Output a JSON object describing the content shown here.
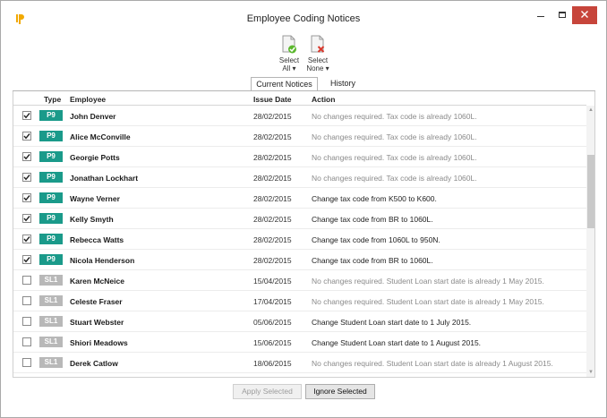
{
  "window": {
    "title": "Employee Coding Notices",
    "min_glyph": "–",
    "close_glyph": "✕"
  },
  "toolbar": {
    "select_all_line1": "Select",
    "select_all_line2": "All ▾",
    "select_none_line1": "Select",
    "select_none_line2": "None ▾"
  },
  "tabs": {
    "current": "Current Notices",
    "history": "History"
  },
  "table": {
    "headers": {
      "type": "Type",
      "employee": "Employee",
      "issue_date": "Issue Date",
      "action": "Action"
    },
    "rows": [
      {
        "checked": true,
        "type": "P9",
        "employee": "John Denver",
        "date": "28/02/2015",
        "action": "No changes required. Tax code is already 1060L.",
        "muted": true
      },
      {
        "checked": true,
        "type": "P9",
        "employee": "Alice McConville",
        "date": "28/02/2015",
        "action": "No changes required. Tax code is already 1060L.",
        "muted": true
      },
      {
        "checked": true,
        "type": "P9",
        "employee": "Georgie Potts",
        "date": "28/02/2015",
        "action": "No changes required. Tax code is already 1060L.",
        "muted": true
      },
      {
        "checked": true,
        "type": "P9",
        "employee": "Jonathan Lockhart",
        "date": "28/02/2015",
        "action": "No changes required. Tax code is already 1060L.",
        "muted": true
      },
      {
        "checked": true,
        "type": "P9",
        "employee": "Wayne Verner",
        "date": "28/02/2015",
        "action": "Change tax code from K500 to K600.",
        "muted": false
      },
      {
        "checked": true,
        "type": "P9",
        "employee": "Kelly Smyth",
        "date": "28/02/2015",
        "action": "Change tax code from BR to 1060L.",
        "muted": false
      },
      {
        "checked": true,
        "type": "P9",
        "employee": "Rebecca Watts",
        "date": "28/02/2015",
        "action": "Change tax code from 1060L to 950N.",
        "muted": false
      },
      {
        "checked": true,
        "type": "P9",
        "employee": "Nicola Henderson",
        "date": "28/02/2015",
        "action": "Change tax code from BR to 1060L.",
        "muted": false
      },
      {
        "checked": false,
        "type": "SL1",
        "employee": "Karen McNeice",
        "date": "15/04/2015",
        "action": "No changes required. Student Loan start date is already 1 May 2015.",
        "muted": true
      },
      {
        "checked": false,
        "type": "SL1",
        "employee": "Celeste Fraser",
        "date": "17/04/2015",
        "action": "No changes required. Student Loan start date is already 1 May 2015.",
        "muted": true
      },
      {
        "checked": false,
        "type": "SL1",
        "employee": "Stuart Webster",
        "date": "05/06/2015",
        "action": "Change Student Loan start date to 1 July 2015.",
        "muted": false
      },
      {
        "checked": false,
        "type": "SL1",
        "employee": "Shiori Meadows",
        "date": "15/06/2015",
        "action": "Change Student Loan start date to 1 August 2015.",
        "muted": false
      },
      {
        "checked": false,
        "type": "SL1",
        "employee": "Derek Catlow",
        "date": "18/06/2015",
        "action": "No changes required. Student Loan start date is already 1 August 2015.",
        "muted": true
      }
    ]
  },
  "buttons": {
    "apply": "Apply Selected",
    "ignore": "Ignore Selected"
  },
  "colors": {
    "p9_badge": "#1a9a8a",
    "sl1_badge": "#b8b8b8",
    "close_button": "#c7453b"
  },
  "icons": {
    "app": "iris-logo-icon",
    "select_all": "document-check-icon",
    "select_none": "document-cross-icon"
  }
}
